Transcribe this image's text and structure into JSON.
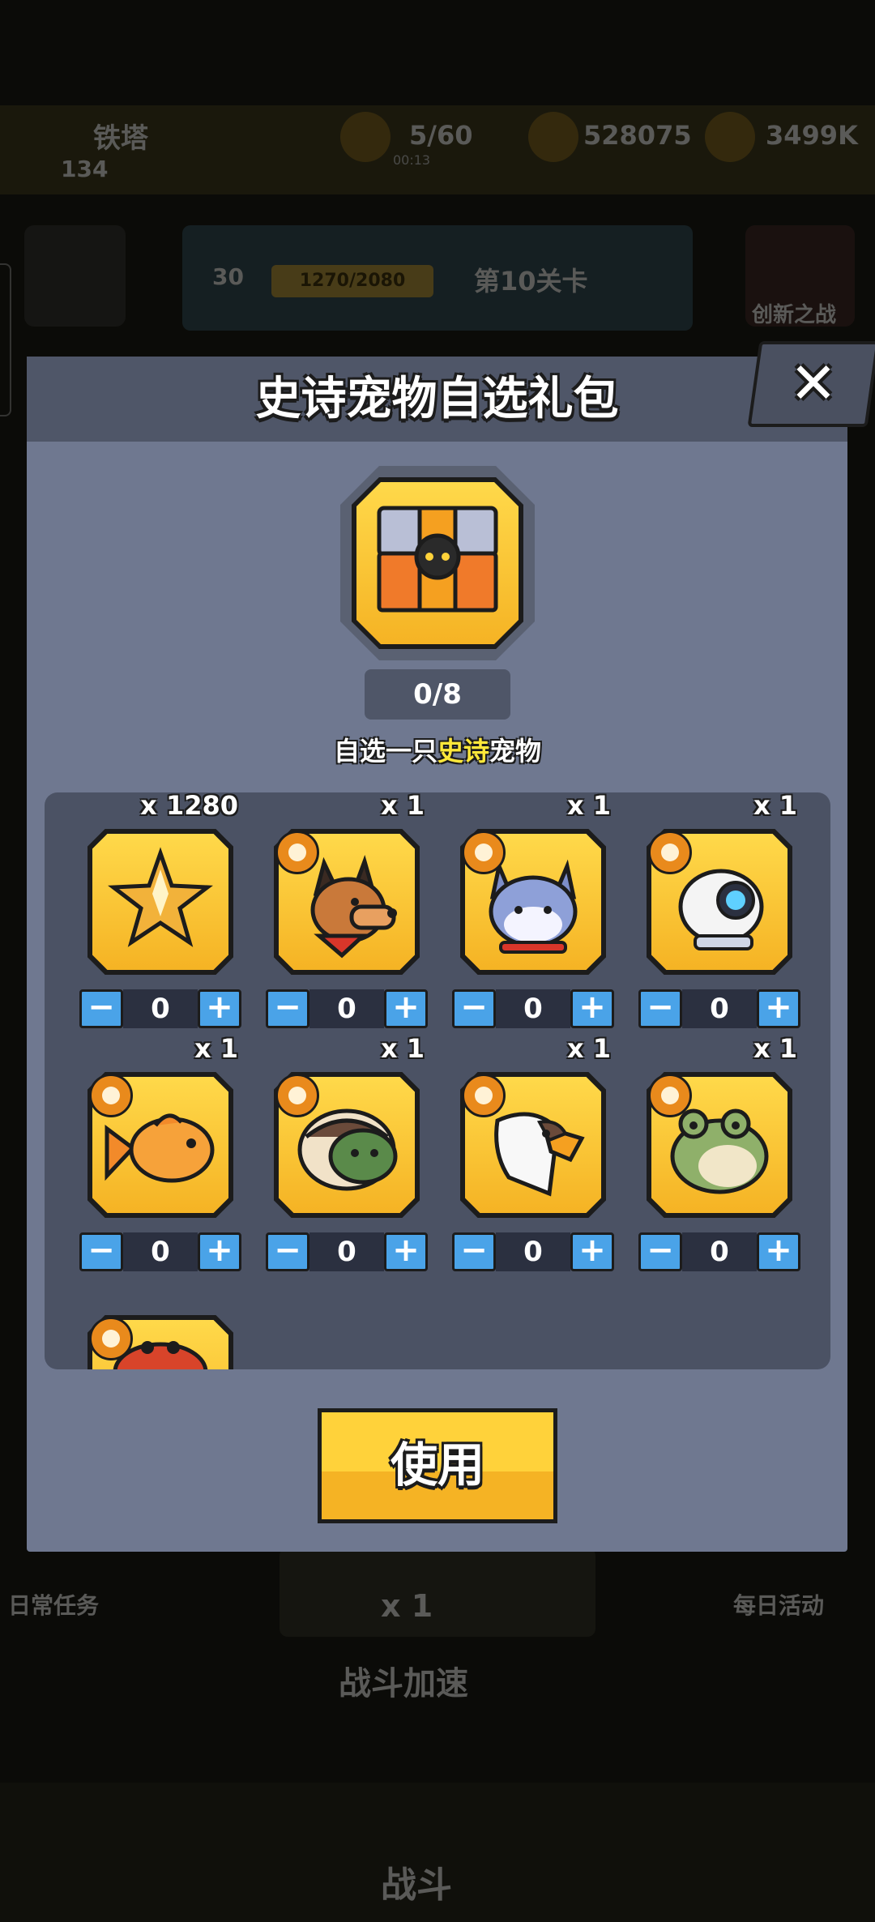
{
  "background": {
    "player_name": "铁塔",
    "player_level": "134",
    "energy": "5/60",
    "energy_timer": "00:13",
    "gems": "528075",
    "coins": "3499K",
    "stage_level": "30",
    "exp": "1270/2080",
    "chapter": "第10关卡",
    "challenge_label": "创新之战",
    "daily_label": "日常任务",
    "event_label": "每日活动",
    "multiplier": "x 1",
    "speed_label": "战斗加速",
    "fight_label": "战斗"
  },
  "modal": {
    "title": "史诗宠物自选礼包",
    "close_label": "✕",
    "progress": "0/8",
    "subtitle_prefix": "自选一只",
    "subtitle_highlight": "史诗",
    "subtitle_suffix": "宠物",
    "use_label": "使用"
  },
  "items": [
    {
      "name": "star-shard",
      "qty": "x 1280",
      "count": "0",
      "icon": "star-shard-icon"
    },
    {
      "name": "dog",
      "qty": "x 1",
      "count": "0",
      "icon": "dog-icon"
    },
    {
      "name": "cat",
      "qty": "x 1",
      "count": "0",
      "icon": "cat-icon"
    },
    {
      "name": "robot",
      "qty": "x 1",
      "count": "0",
      "icon": "robot-icon"
    },
    {
      "name": "goldfish",
      "qty": "x 1",
      "count": "0",
      "icon": "goldfish-icon"
    },
    {
      "name": "turtle",
      "qty": "x 1",
      "count": "0",
      "icon": "turtle-icon"
    },
    {
      "name": "eagle",
      "qty": "x 1",
      "count": "0",
      "icon": "eagle-icon"
    },
    {
      "name": "frog",
      "qty": "x 1",
      "count": "0",
      "icon": "frog-icon"
    },
    {
      "name": "crab",
      "qty": "",
      "count": "",
      "icon": "crab-icon"
    }
  ],
  "stepper": {
    "minus": "−",
    "plus": "+"
  },
  "colors": {
    "accent_gold": "#f5b324",
    "highlight_yellow": "#ffe83a",
    "modal_bg": "#6f7890",
    "stepper_blue": "#4aa3e8"
  }
}
